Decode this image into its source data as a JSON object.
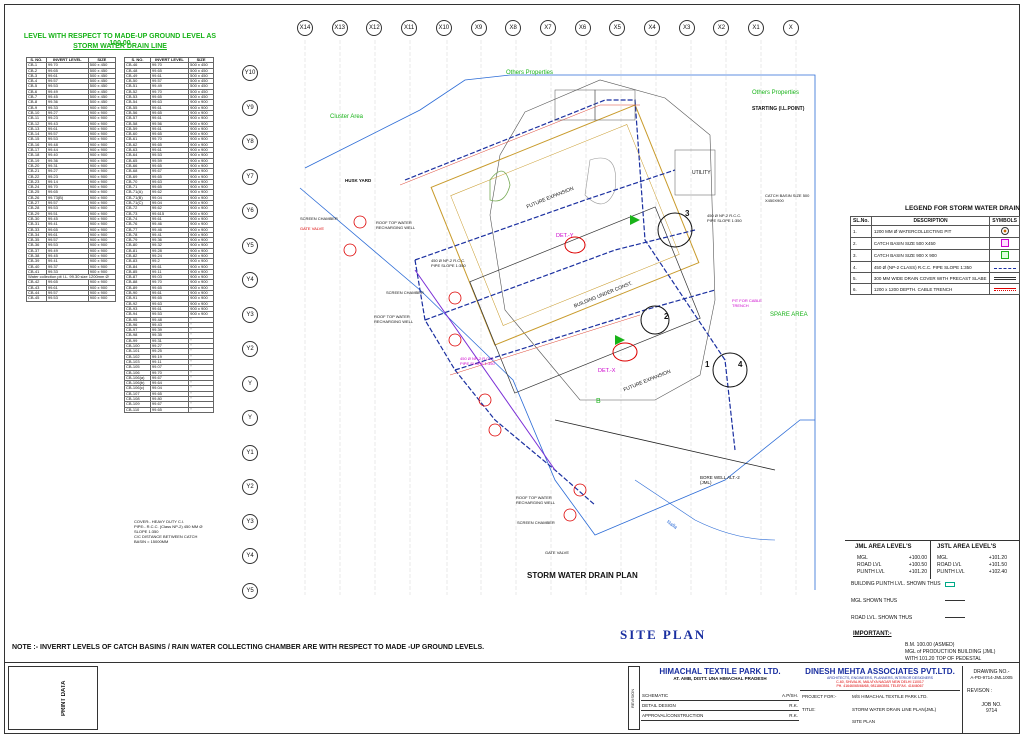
{
  "header": {
    "line1": "LEVEL WITH RESPECT TO MADE-UP GROUND LEVEL AS 100.00",
    "line2": "STORM WATER DRAIN LINE"
  },
  "schedule_left": {
    "columns": [
      "S. NO.",
      "INVERT LEVEL",
      "SIZE"
    ],
    "rows": [
      [
        "CB-1",
        "99.70",
        "500 x 450"
      ],
      [
        "CB-2",
        "99.65",
        "500 x 450"
      ],
      [
        "CB-3",
        "99.61",
        "500 x 450"
      ],
      [
        "CB-4",
        "99.57",
        "500 x 450"
      ],
      [
        "CB-5",
        "99.53",
        "500 x 450"
      ],
      [
        "CB-6",
        "99.49",
        "500 x 450"
      ],
      [
        "CB-7",
        "99.45",
        "500 x 450"
      ],
      [
        "CB-8",
        "99.36",
        "500 x 450"
      ],
      [
        "CB-9",
        "99.33",
        "900 x 900"
      ],
      [
        "CB-10",
        "99.27",
        "900 x 900"
      ],
      [
        "CB-11",
        "99.23",
        "900 x 900"
      ],
      [
        "CB-12",
        "99.43",
        "900 x 900"
      ],
      [
        "CB-13",
        "99.61",
        "900 x 900"
      ],
      [
        "CB-14",
        "99.57",
        "900 x 900"
      ],
      [
        "CB-15",
        "99.53",
        "900 x 900"
      ],
      [
        "CB-16",
        "99.48",
        "900 x 900"
      ],
      [
        "CB-17",
        "99.44",
        "900 x 900"
      ],
      [
        "CB-18",
        "99.40",
        "900 x 900"
      ],
      [
        "CB-19",
        "99.36",
        "900 x 900"
      ],
      [
        "CB-20",
        "99.31",
        "900 x 900"
      ],
      [
        "CB-21",
        "99.27",
        "900 x 900"
      ],
      [
        "CB-22",
        "99.23",
        "900 x 900"
      ],
      [
        "CB-23",
        "99.14",
        "900 x 900"
      ],
      [
        "CB-24",
        "99.70",
        "900 x 900"
      ],
      [
        "CB-25",
        "99.65",
        "900 x 900"
      ],
      [
        "CB-26",
        "99.73(B)",
        "900 x 900"
      ],
      [
        "CB-27",
        "99.57",
        "900 x 900"
      ],
      [
        "CB-28",
        "99.53",
        "900 x 900"
      ],
      [
        "CB-29",
        "99.51",
        "900 x 900"
      ],
      [
        "CB-30",
        "99.45",
        "900 x 900"
      ],
      [
        "CB-31",
        "99.41",
        "900 x 900"
      ],
      [
        "CB-33",
        "99.65",
        "900 x 900"
      ],
      [
        "CB-34",
        "99.61",
        "900 x 900"
      ],
      [
        "CB-35",
        "99.57",
        "900 x 900"
      ],
      [
        "CB-36",
        "99.53",
        "900 x 900"
      ],
      [
        "CB-37",
        "99.49",
        "900 x 900"
      ],
      [
        "CB-38",
        "99.45",
        "900 x 900"
      ],
      [
        "CB-39",
        "99.41",
        "900 x 900"
      ],
      [
        "CB-40",
        "99.37",
        "900 x 900"
      ],
      [
        "CB-41",
        "99.33",
        "900 x 900"
      ]
    ],
    "special_row": "Water collection pit I.L. 99.30 size 1200mm Ø",
    "rows2": [
      [
        "CB-42",
        "99.65",
        "900 x 900"
      ],
      [
        "CB-43",
        "99.61",
        "900 x 900"
      ],
      [
        "CB-44",
        "99.57",
        "900 x 900"
      ],
      [
        "CB-45",
        "99.53",
        "900 x 900"
      ]
    ]
  },
  "schedule_right": {
    "columns": [
      "S. NO.",
      "INVERT LEVEL",
      "SIZE"
    ],
    "rows": [
      [
        "CB-46",
        "99.70",
        "500 x 450"
      ],
      [
        "CB-48",
        "99.65",
        "500 x 450"
      ],
      [
        "CB-49",
        "99.61",
        "500 x 450"
      ],
      [
        "CB-50",
        "99.57",
        "500 x 450"
      ],
      [
        "CB-51",
        "99.49",
        "500 x 450"
      ],
      [
        "CB-52",
        "99.70",
        "500 x 450"
      ],
      [
        "CB-53",
        "99.65",
        "500 x 450"
      ],
      [
        "CB-54",
        "99.63",
        "900 x 900"
      ],
      [
        "CB-55",
        "99.61",
        "900 x 900"
      ],
      [
        "CB-56",
        "99.65",
        "900 x 900"
      ],
      [
        "CB-57",
        "99.61",
        "900 x 900"
      ],
      [
        "CB-58",
        "99.56",
        "900 x 900"
      ],
      [
        "CB-59",
        "99.61",
        "900 x 900"
      ],
      [
        "CB-60",
        "99.65",
        "900 x 900"
      ],
      [
        "CB-61",
        "99.70",
        "900 x 900"
      ],
      [
        "CB-62",
        "99.65",
        "900 x 900"
      ],
      [
        "CB-63",
        "99.61",
        "900 x 900"
      ],
      [
        "CB-64",
        "99.53",
        "900 x 900"
      ],
      [
        "CB-65",
        "99.59",
        "900 x 900"
      ],
      [
        "CB-66",
        "99.65",
        "900 x 900"
      ],
      [
        "CB-68",
        "99.67",
        "900 x 900"
      ],
      [
        "CB-69",
        "99.65",
        "900 x 900"
      ],
      [
        "CB-70",
        "99.63",
        "900 x 900"
      ],
      [
        "CB-71",
        "99.65",
        "900 x 900"
      ],
      [
        "CB-71(A)",
        "99.62",
        "900 x 900"
      ],
      [
        "CB-71(B)",
        "99.04",
        "900 x 900"
      ],
      [
        "CB-71(C)",
        "99.04",
        "900 x 900"
      ],
      [
        "CB-72",
        "99.62",
        "900 x 900"
      ],
      [
        "CB-73",
        "99.615",
        "900 x 900"
      ],
      [
        "CB-74",
        "99.61",
        "900 x 900"
      ],
      [
        "CB-76",
        "99.46",
        "900 x 900"
      ],
      [
        "CB-77",
        "99.46",
        "900 x 900"
      ],
      [
        "CB-78",
        "99.41",
        "900 x 900"
      ],
      [
        "CB-79",
        "99.36",
        "900 x 900"
      ],
      [
        "CB-80",
        "99.32",
        "900 x 900"
      ],
      [
        "CB-81",
        "99.28",
        "900 x 900"
      ],
      [
        "CB-82",
        "99.24",
        "900 x 900"
      ],
      [
        "CB-83",
        "99.2",
        "900 x 900"
      ],
      [
        "CB-84",
        "99.61",
        "900 x 900"
      ],
      [
        "CB-85",
        "99.11",
        "900 x 900"
      ],
      [
        "CB-87",
        "99.03",
        "900 x 900"
      ],
      [
        "CB-88",
        "99.70",
        "900 x 900"
      ],
      [
        "CB-89",
        "99.65",
        "900 x 900"
      ],
      [
        "CB-90",
        "99.61",
        "900 x 900"
      ],
      [
        "CB-91",
        "99.65",
        "900 x 900"
      ],
      [
        "CB-92",
        "99.63",
        "900 x 900"
      ],
      [
        "CB-93",
        "99.61",
        "900 x 900"
      ],
      [
        "CB-94",
        "99.53",
        "900 x 900"
      ],
      [
        "CB-95",
        "99.48",
        "\""
      ],
      [
        "CB-96",
        "99.43",
        "\""
      ],
      [
        "CB-97",
        "99.39",
        "\""
      ],
      [
        "CB-98",
        "99.35",
        "\""
      ],
      [
        "CB-99",
        "99.31",
        "\""
      ],
      [
        "CB-100",
        "99.27",
        "\""
      ],
      [
        "CB-101",
        "99.25",
        "\""
      ],
      [
        "CB-102",
        "99.19",
        "\""
      ],
      [
        "CB-103",
        "99.11",
        "\""
      ],
      [
        "CB-105",
        "99.07",
        "\""
      ],
      [
        "CB-106",
        "99.70",
        "\""
      ],
      [
        "CB-106(a)",
        "99.67",
        "\""
      ],
      [
        "CB-106(b)",
        "99.64",
        "\""
      ],
      [
        "CB-106(c)",
        "99.04",
        "\""
      ],
      [
        "CB-107",
        "99.65",
        "\""
      ],
      [
        "CB-108",
        "99.80",
        "\""
      ],
      [
        "CB-109",
        "99.67",
        "\""
      ],
      [
        "CB-110",
        "99.65",
        "\""
      ]
    ],
    "notes": [
      "COVER:- HEAVY DUTY C.I.",
      "PIPE:- R.C.C. (Class NP-2) 450 MM Ø",
      "SLOPE 1:350",
      "C/C DISTANCE BETWEEN CATCH",
      "BASIN = 15000MM"
    ]
  },
  "grid": {
    "columns": [
      "X14",
      "X13",
      "X12",
      "X11",
      "X10",
      "X9",
      "X8",
      "X7",
      "X6",
      "X5",
      "X4",
      "X3",
      "X2",
      "X1",
      "X"
    ],
    "rows": [
      "Y10",
      "Y9",
      "Y8",
      "Y7",
      "Y6",
      "Y5",
      "Y4",
      "Y3",
      "Y2",
      "Y",
      "Y",
      "Y1",
      "Y2",
      "Y3",
      "Y4",
      "Y5"
    ]
  },
  "plan_labels": {
    "others1": "Others Properties",
    "others2": "Others Properties",
    "cluster": "Cluster Area",
    "starting": "STARTING (I.L.POINT)",
    "husk": "HUSK YARD",
    "future1": "FUTURE EXPANSION",
    "future2": "FUTURE EXPANSION",
    "building": "BUILDING UNDER CONST.",
    "spare": "SPARE AREA",
    "utility": "UTILITY",
    "det_y": "DET.-Y",
    "det_x": "DET.-X",
    "borewell": "BORE WELL ALT.-2 (JML)",
    "nalla": "Nalla",
    "gate1": "GATE VALVE",
    "gate2": "GATE VALVE",
    "screen1": "SCREEN CHAMBER",
    "screen2": "SCREEN CHAMBER",
    "screen3": "SCREEN CHAMBER",
    "roof1": "ROOF TOP WATER RECHARGING WELL",
    "roof2": "ROOF TOP WATER RECHARGING WELL",
    "roof3": "ROOF TOP WATER RECHARGING WELL",
    "pipe1": "450 Ø NP-2 R.C.C. PIPE SLOPE 1:350",
    "pipe2": "450 Ø NP-2 R.C.C. PIPE SLOPE 1:350",
    "pipe3": "450 Ø NP-2 R.C.C. PIPE SLOPE 1:350",
    "catch": "CATCH BASIN SIZE 500 X450X900",
    "pit": "PIT FOR CABLE TRENCH",
    "drawing_title": "STORM WATER DRAIN PLAN",
    "callouts": [
      "1",
      "2",
      "3",
      "4"
    ],
    "b_label": "B"
  },
  "legend": {
    "title": "LEGEND FOR STORM WATER DRAIN",
    "columns": [
      "SL.No.",
      "DESCRIPTION",
      "SYMBOLS"
    ],
    "rows": [
      [
        "1.",
        "1200 MM Ø WATERCOLLECTING PIT"
      ],
      [
        "2.",
        "CATCH BASIN SIZE 500 X450"
      ],
      [
        "3.",
        "CATCH BASIN SIZE 900 X 900"
      ],
      [
        "4.",
        "450 Ø (NP-2 CLASS) R.C.C. PIPE SLOPE 1:350"
      ],
      [
        "5.",
        "300 MM WIDE DRAIN COVER WITH PRECAST SLABE"
      ],
      [
        "6.",
        "1200 x 1200 DEPTH. CABLE TRENCH"
      ]
    ]
  },
  "levels": {
    "jml_title": "JML AREA LEVEL'S",
    "jml": [
      [
        "MGL",
        "+100.00"
      ],
      [
        "ROAD LVL",
        "+100.50"
      ],
      [
        "PLINTH LVL",
        "+101.20"
      ]
    ],
    "jstl_title": "JSTL AREA LEVEL'S",
    "jstl": [
      [
        "MGL",
        "+101.20"
      ],
      [
        "ROAD LVL",
        "+101.50"
      ],
      [
        "PLINTH LVL",
        "+102.40"
      ]
    ],
    "shown": [
      "BUILDING PLINTH LVL. SHOWN THUS",
      "MGL SHOWN THUS",
      "ROAD LVL. SHOWN THUS"
    ],
    "important": "IMPORTANT:-",
    "imp_lines": [
      "B.M. 100.00 (ASMED)",
      "MGL of PRODUCTION BUILDING (JML)",
      "WITH 101.20 TOP OF PEDESTAL"
    ]
  },
  "site_plan": "SITE PLAN",
  "note": "NOTE :- INVERRT LEVELS OF CATCH BASINS / RAIN WATER COLLECTING CHAMBER ARE WITH RESPECT TO MADE -UP GROUND LEVELS.",
  "titleblock": {
    "client": "HIMACHAL TEXTILE PARK LTD.",
    "client_addr": "AT. AMB, DISTT. UNA HIMACHAL PRADESH",
    "firm": "DINESH MEHTA ASSOCIATES PVT.LTD.",
    "firm_sub": "ARCHITECTS, ENGINEERS, PLANNERS, INTERIOR DESIGNERS",
    "firm_addr": "C-60, SHIVALIK, MALVIYA NAGAR NEW DELHI 110017",
    "firm_ph": "PH. 41646065/66/68, 9811863551  TELEFAX. 41646067",
    "project_label": "PROJECT FOR:-",
    "project": "M/S HIMACHAL TEXTILE PARK LTD.",
    "title_label": "TITLE:",
    "title1": "STORM WATER DRAIN LINE PLAN(JML)",
    "title2": "SITE PLAN",
    "drawing_no_label": "DRAWING NO.-",
    "drawing_no": "A-PD-9714-JML1005",
    "revision": "REVISON :",
    "job_label": "JOB NO.",
    "job": "9714",
    "print_data": "PRINT DATA",
    "revision_v": "REVISION",
    "stages": [
      "SCHEMATIC",
      "DETAIL DESIGN",
      "APPROVAL/CONSTRUCTION"
    ],
    "checks": [
      "A.P/SH.",
      "R.K.",
      "R.K."
    ]
  }
}
